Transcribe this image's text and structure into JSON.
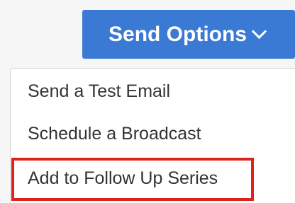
{
  "toolbar": {
    "send_options_label": "Send Options"
  },
  "dropdown": {
    "items": [
      {
        "label": "Send a Test Email"
      },
      {
        "label": "Schedule a Broadcast"
      },
      {
        "label": "Add to Follow Up Series"
      }
    ],
    "highlighted_index": 2
  },
  "colors": {
    "button_bg": "#3a7ad5",
    "highlight_border": "#e0221c",
    "menu_text": "#333333"
  },
  "icons": {
    "button_icon": "chevron-down-icon"
  }
}
